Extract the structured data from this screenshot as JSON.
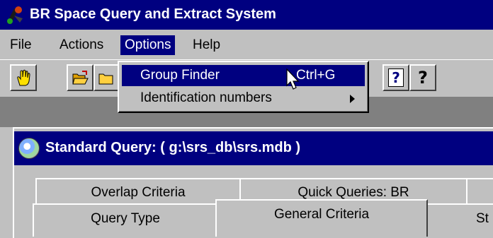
{
  "window": {
    "title": "BR Space Query and Extract System"
  },
  "menubar": {
    "items": [
      {
        "label": "File"
      },
      {
        "label": "Actions"
      },
      {
        "label": "Options"
      },
      {
        "label": "Help"
      }
    ]
  },
  "options_menu": {
    "items": [
      {
        "label": "Group Finder",
        "shortcut": "Ctrl+G"
      },
      {
        "label": "Identification numbers"
      }
    ]
  },
  "toolbar": {
    "buttons": [
      {
        "icon": "hand-icon"
      },
      {
        "icon": "open-folder-icon"
      },
      {
        "icon": "folder-icon"
      },
      {
        "icon": "context-help-icon",
        "label": "?"
      },
      {
        "icon": "help-icon",
        "label": "?"
      }
    ]
  },
  "child_window": {
    "title": "Standard Query:    ( g:\\srs_db\\srs.mdb )"
  },
  "tabs": {
    "back_row": [
      "Overlap Criteria",
      "Quick Queries: BR"
    ],
    "front_row": [
      "Query Type",
      "General Criteria",
      "St"
    ]
  },
  "colors": {
    "titlebar": "#000080",
    "face": "#c0c0c0",
    "workspace": "#808080",
    "highlight": "#000080"
  }
}
